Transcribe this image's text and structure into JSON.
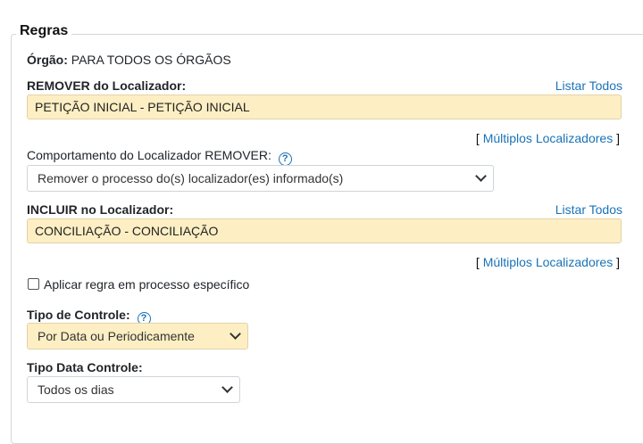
{
  "section": {
    "title": "Regras"
  },
  "orgao": {
    "label": "Órgão:",
    "value": "PARA TODOS OS ÓRGÃOS"
  },
  "remover": {
    "label": "REMOVER do Localizador:",
    "listar_todos": "Listar Todos",
    "value": "PETIÇÃO INICIAL - PETIÇÃO INICIAL",
    "multiplos_open": "[",
    "multiplos": "Múltiplos Localizadores",
    "multiplos_close": "]"
  },
  "comportamento": {
    "label": "Comportamento do Localizador REMOVER:",
    "help_icon": "?",
    "selected": "Remover o processo do(s) localizador(es) informado(s)"
  },
  "incluir": {
    "label": "INCLUIR no Localizador:",
    "listar_todos": "Listar Todos",
    "value": "CONCILIAÇÃO - CONCILIAÇÃO",
    "multiplos_open": "[",
    "multiplos": "Múltiplos Localizadores",
    "multiplos_close": "]"
  },
  "aplicar_regra": {
    "label": "Aplicar regra em processo específico",
    "checked": false
  },
  "tipo_controle": {
    "label": "Tipo de Controle:",
    "help_icon": "?",
    "selected": "Por Data ou Periodicamente"
  },
  "tipo_data_controle": {
    "label": "Tipo Data Controle:",
    "selected": "Todos os dias"
  },
  "colors": {
    "link": "#1a73b8",
    "highlight": "#fdefc3"
  }
}
